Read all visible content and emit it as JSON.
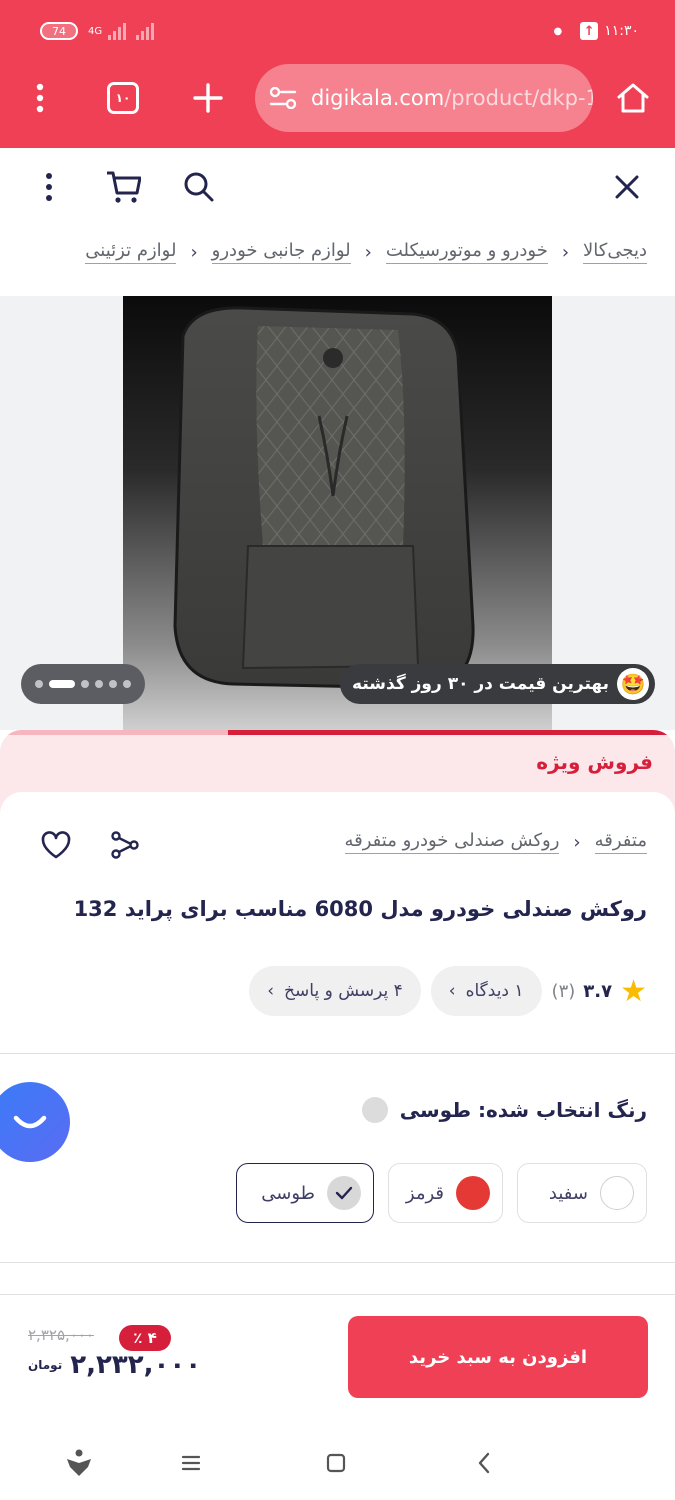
{
  "status_bar": {
    "battery": "74",
    "network": "4G",
    "time": "۱۱:۳۰"
  },
  "browser": {
    "tab_count": "۱۰",
    "url_host": "digikala.com",
    "url_path": "/product/dkp-1"
  },
  "breadcrumb": [
    "دیجی‌کالا",
    "خودرو و موتورسیکلت",
    "لوازم جانبی خودرو",
    "لوازم تزئینی"
  ],
  "gallery": {
    "badge_text": "بهترین قیمت در ۳۰ روز گذشته",
    "badge_emoji": "🤩",
    "image_alt": "car seat cover"
  },
  "special_sale": "فروش ویژه",
  "product": {
    "category": [
      "متفرقه",
      "روکش صندلی خودرو متفرقه"
    ],
    "title": "روکش صندلی خودرو مدل 6080 مناسب برای پراید 132",
    "rating_value": "۳.۷",
    "rating_count": "(۳)",
    "reviews_pill": "۱ دیدگاه",
    "questions_pill": "۴ پرسش و پاسخ",
    "selected_color_label": "رنگ انتخاب شده: طوسی",
    "color_options": [
      {
        "name": "سفید",
        "color": "#ffffff",
        "selected": false
      },
      {
        "name": "قرمز",
        "color": "#e53935",
        "selected": false
      },
      {
        "name": "طوسی",
        "color": "#d8d8d8",
        "selected": true
      }
    ]
  },
  "buy": {
    "button_label": "افزودن به سبد خرید",
    "old_price": "۲,۳۲۵,۰۰۰",
    "discount": "۴ ٪",
    "price": "۲,۲۳۲,۰۰۰",
    "currency": "تومان"
  },
  "colors": {
    "brand": "#ef4056",
    "sale_red": "#d61f3b",
    "star": "#f9bc00"
  }
}
